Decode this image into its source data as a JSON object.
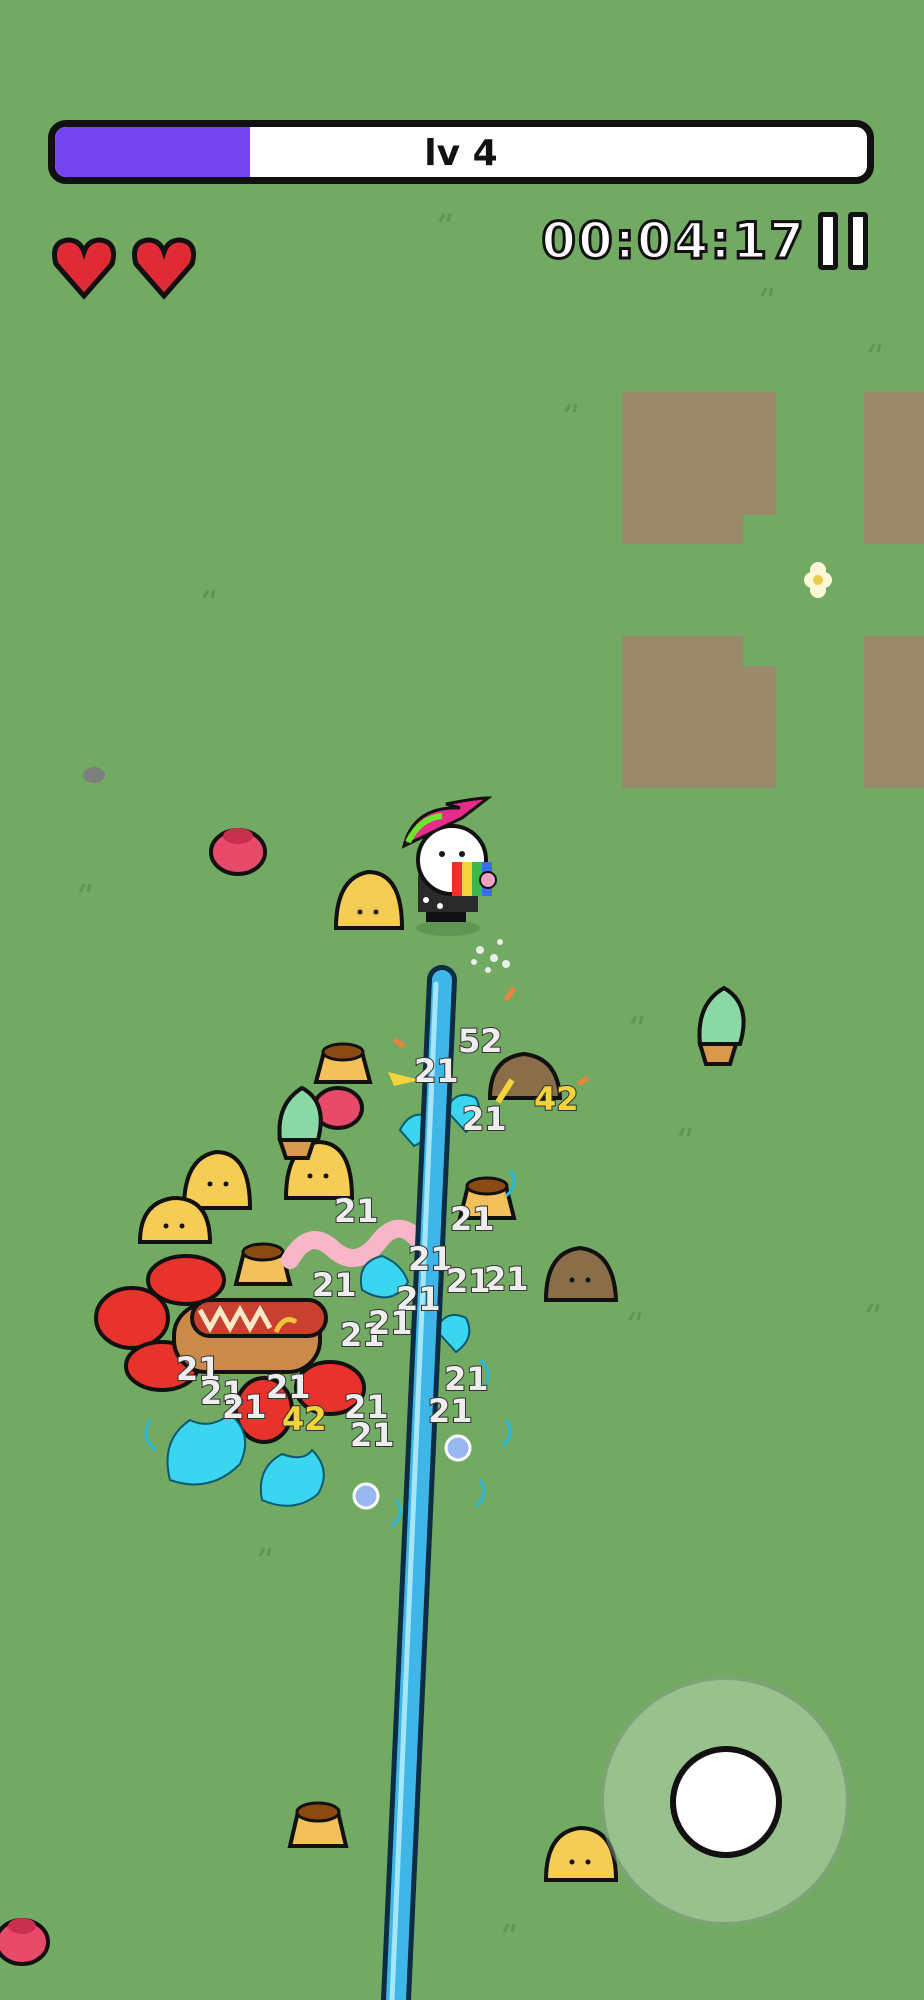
{
  "hud": {
    "level_label": "lv 4",
    "xp_progress": 0.24,
    "timer": "00:04:17",
    "hearts": 2,
    "xp_color": "#7444f0"
  },
  "icons": {
    "heart": "heart-icon",
    "pause": "pause-icon"
  },
  "damage_numbers": [
    {
      "text": "52",
      "crit": false
    },
    {
      "text": "21",
      "crit": false
    },
    {
      "text": "42",
      "crit": true
    },
    {
      "text": "21",
      "crit": false
    },
    {
      "text": "21",
      "crit": false
    },
    {
      "text": "21",
      "crit": false
    },
    {
      "text": "21",
      "crit": false
    },
    {
      "text": "21",
      "crit": false
    },
    {
      "text": "21",
      "crit": false
    },
    {
      "text": "21",
      "crit": false
    },
    {
      "text": "21",
      "crit": false
    },
    {
      "text": "21",
      "crit": false
    },
    {
      "text": "21",
      "crit": false
    },
    {
      "text": "21",
      "crit": false
    },
    {
      "text": "21",
      "crit": false
    },
    {
      "text": "21",
      "crit": false
    },
    {
      "text": "21",
      "crit": false
    },
    {
      "text": "42",
      "crit": true
    },
    {
      "text": "21",
      "crit": false
    },
    {
      "text": "21",
      "crit": false
    },
    {
      "text": "21",
      "crit": false
    },
    {
      "text": "21",
      "crit": false
    }
  ],
  "colors": {
    "grass": "#72a963",
    "dirt": "#9a8a6a",
    "beam": "#3fb6e8"
  }
}
